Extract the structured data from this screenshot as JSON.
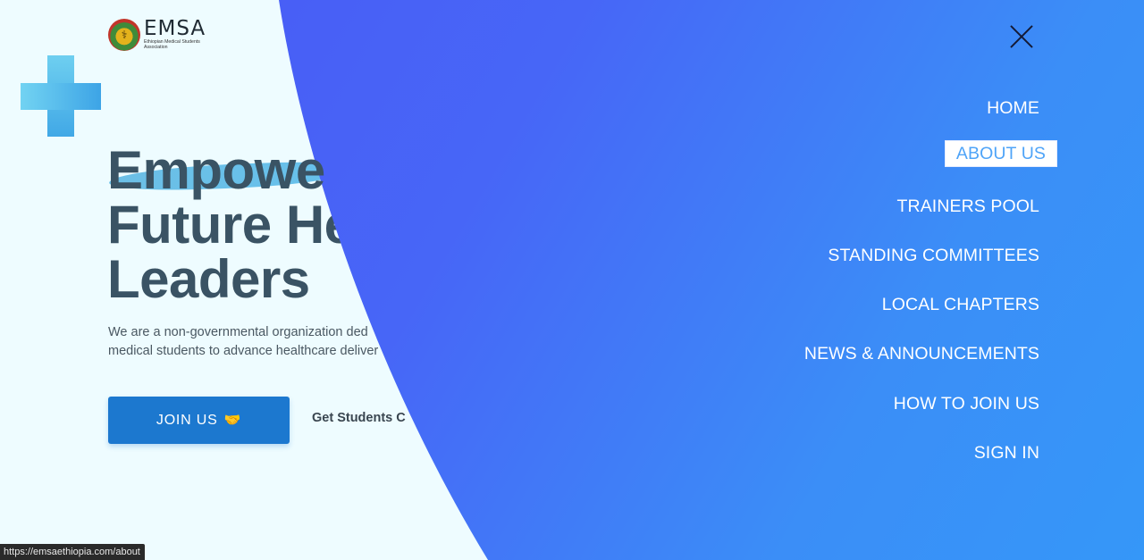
{
  "brand": {
    "name": "EMSA",
    "subtitle": "Ethiopian Medical Students Association",
    "logo_icon": "emsa-seal-icon"
  },
  "hero": {
    "headline_lines": [
      "Empowe",
      "Future He",
      "Leaders"
    ],
    "intro_lines": [
      "We are a non-governmental organization ded",
      "medical students to advance healthcare deliver"
    ],
    "join_button": "JOIN US",
    "join_icon": "handshake-icon",
    "students_link": "Get Students C"
  },
  "menu": {
    "close_icon": "close-icon",
    "items": [
      {
        "label": "HOME",
        "active": false
      },
      {
        "label": "ABOUT US",
        "active": true
      },
      {
        "label": "TRAINERS POOL",
        "active": false
      },
      {
        "label": "STANDING COMMITTEES",
        "active": false
      },
      {
        "label": "LOCAL CHAPTERS",
        "active": false
      },
      {
        "label": "NEWS & ANNOUNCEMENTS",
        "active": false
      },
      {
        "label": "HOW TO JOIN US",
        "active": false
      },
      {
        "label": "SIGN IN",
        "active": false
      }
    ]
  },
  "status_bar": {
    "url": "https://emsaethiopia.com/about"
  },
  "colors": {
    "page_background": "#eefcff",
    "overlay_start": "#4a58f5",
    "overlay_end": "#3597f8",
    "join_button": "#1c78cf",
    "headline": "#3a5364",
    "active_menu_text": "#4fa4f8"
  }
}
